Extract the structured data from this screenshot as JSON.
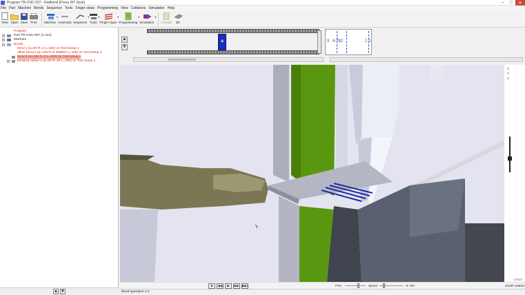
{
  "window": {
    "title": "Program TR-CNC-007 - Radbend [Press WT Style]",
    "controls": [
      "–",
      "□",
      "✕"
    ]
  },
  "menu": [
    "File",
    "Part",
    "Machine",
    "Bends",
    "Sequence",
    "Tools",
    "Finger stops",
    "Programming",
    "View",
    "Collisions",
    "Simulation",
    "Help"
  ],
  "toolbar": {
    "view": "View",
    "open": "Open",
    "save": "Save",
    "print": "Print",
    "machine": "Machine",
    "automatic": "Automatic",
    "sequence": "Sequence",
    "tools": "Tools",
    "finger_stops": "Finger stops",
    "programming": "Programming",
    "simulation": "Simulation",
    "compile": "Compile",
    "view3d": "3D"
  },
  "tree": {
    "program": "Program",
    "part": "Part TR-CNC-007 (1 mm)",
    "machine": "Machine",
    "bends": "Bends",
    "items": [
      "bend 1 (a=90 R=1 L=160) on Tool Setup 1",
      "offset bend 2 (a=135 R=0.398067 L=160) on Tool Setup 1",
      "bend 3 (a=165 R=0 L=160) on Tool Setup 1",
      "bumped radius 4 (a=90 R=35 L=160) on Tool Setup 1"
    ]
  },
  "sequence": {
    "marker_label": "a",
    "mini_left": "1",
    "mini_mid": "4.782",
    "mini_right": "2.3"
  },
  "viewport": {
    "z_value": "-173.0",
    "model_rotation": "Model rotation",
    "axes": [
      "X",
      "Y",
      "Z"
    ]
  },
  "playback": {
    "stop": "■",
    "back": "◀◀",
    "play": "▶",
    "next": "▶▶",
    "end": "▶▶|",
    "fps_label": "FPS",
    "speed_label": "Speed",
    "speed_value": "% 750"
  },
  "status": {
    "operation": "Bend operation 4.2"
  },
  "colors": {
    "accent": "#1a2fb8",
    "program_text": "#d8261a",
    "press_green": "#5c9d10"
  }
}
